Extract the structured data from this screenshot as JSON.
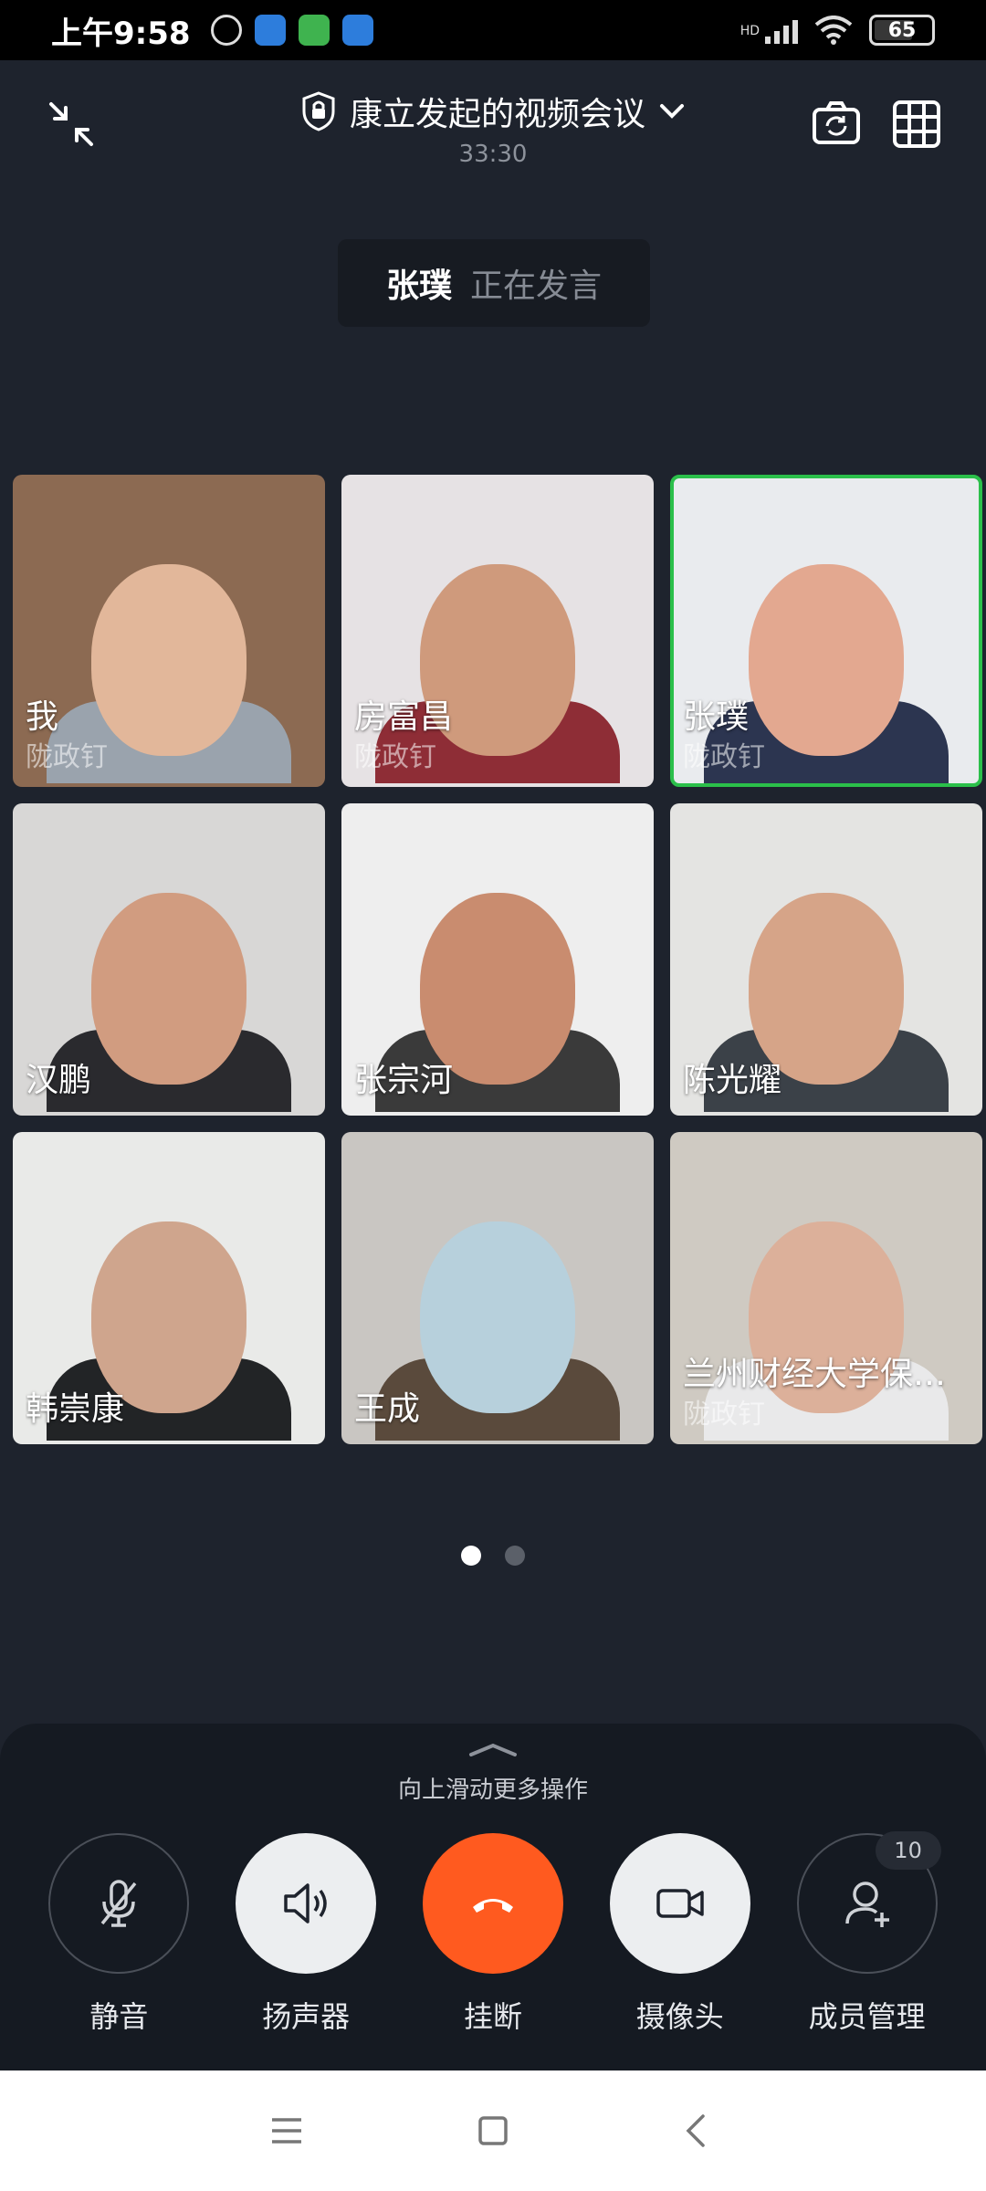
{
  "status_bar": {
    "time": "上午9:58",
    "battery": "65",
    "network": "HD"
  },
  "header": {
    "title": "康立发起的视频会议",
    "timer": "33:30"
  },
  "speaker": {
    "name": "张璞",
    "status": "正在发言"
  },
  "participants": [
    {
      "name": "我",
      "org": "陇政钉",
      "bg": "#8c6a52",
      "face": "#e2b79a",
      "body": "#9aa3ad",
      "active": false
    },
    {
      "name": "房富昌",
      "org": "陇政钉",
      "bg": "#e6e2e4",
      "face": "#cf9a7c",
      "body": "#8e2d36",
      "active": false
    },
    {
      "name": "张璞",
      "org": "陇政钉",
      "bg": "#e9ebee",
      "face": "#e3a890",
      "body": "#2c3550",
      "active": true
    },
    {
      "name": "汉鹏",
      "org": "",
      "bg": "#d8d7d6",
      "face": "#d19c80",
      "body": "#2a2a2e",
      "active": false
    },
    {
      "name": "张宗河",
      "org": "",
      "bg": "#eeeeee",
      "face": "#c98c6f",
      "body": "#3a3a3a",
      "active": false
    },
    {
      "name": "陈光耀",
      "org": "",
      "bg": "#e4e4e2",
      "face": "#d6a488",
      "body": "#3b4148",
      "active": false
    },
    {
      "name": "韩崇康",
      "org": "",
      "bg": "#e9eae8",
      "face": "#cfa58d",
      "body": "#222426",
      "active": false
    },
    {
      "name": "王成",
      "org": "",
      "bg": "#c9c6c2",
      "face": "#b7d0dc",
      "body": "#5a4a3c",
      "active": false
    },
    {
      "name": "兰州财经大学保…",
      "org": "陇政钉",
      "bg": "#cfcac2",
      "face": "#dcb09a",
      "body": "#e9e9ea",
      "active": false
    }
  ],
  "pager": {
    "pages": 2,
    "current": 1
  },
  "panel": {
    "hint": "向上滑动更多操作",
    "controls": [
      {
        "label": "静音",
        "icon": "mic-off-icon"
      },
      {
        "label": "扬声器",
        "icon": "speaker-icon"
      },
      {
        "label": "挂断",
        "icon": "hangup-icon"
      },
      {
        "label": "摄像头",
        "icon": "camera-icon"
      },
      {
        "label": "成员管理",
        "icon": "add-member-icon"
      }
    ],
    "member_count": "10"
  },
  "colors": {
    "accent_active": "#2bbf4a",
    "hangup": "#ff5a1f",
    "background": "#1e232d"
  }
}
